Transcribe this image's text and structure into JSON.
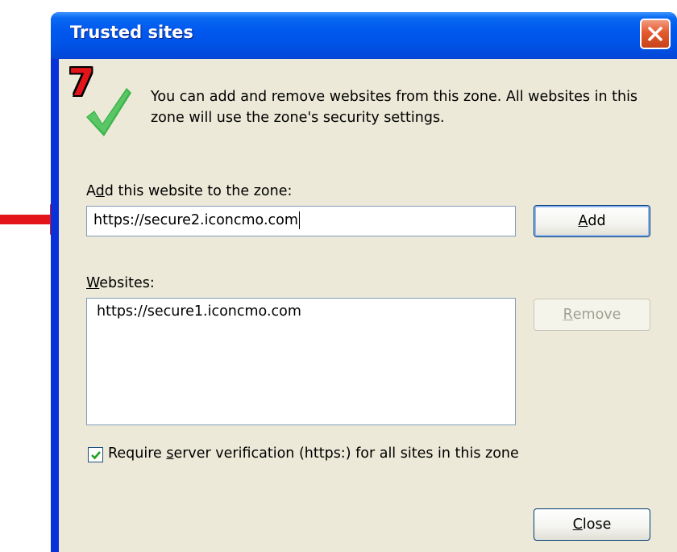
{
  "dialog": {
    "title": "Trusted sites",
    "step_number": "7",
    "info_text": "You can add and remove websites from this zone. All websites in this zone will use the zone's security settings."
  },
  "add_site": {
    "label_pre": "A",
    "label_ul": "d",
    "label_post": "d this website to the zone:",
    "input_value": "https://secure2.iconcmo.com",
    "button_ul": "A",
    "button_post": "dd"
  },
  "websites": {
    "label_ul": "W",
    "label_post": "ebsites:",
    "items": [
      "https://secure1.iconcmo.com"
    ],
    "remove_ul": "R",
    "remove_post": "emove"
  },
  "require_https": {
    "checked": true,
    "label_pre": "Require ",
    "label_ul": "s",
    "label_post": "erver verification (https:) for all sites in this zone"
  },
  "close_button": {
    "ul": "C",
    "post": "lose"
  },
  "colors": {
    "titlebar": "#0053e6",
    "dialog_bg": "#ece9d8",
    "arrow": "#e3141a",
    "check": "#3ab54a"
  },
  "icons": [
    "close-icon",
    "checkmark-icon",
    "arrow-right-icon",
    "checkbox-check-icon"
  ]
}
